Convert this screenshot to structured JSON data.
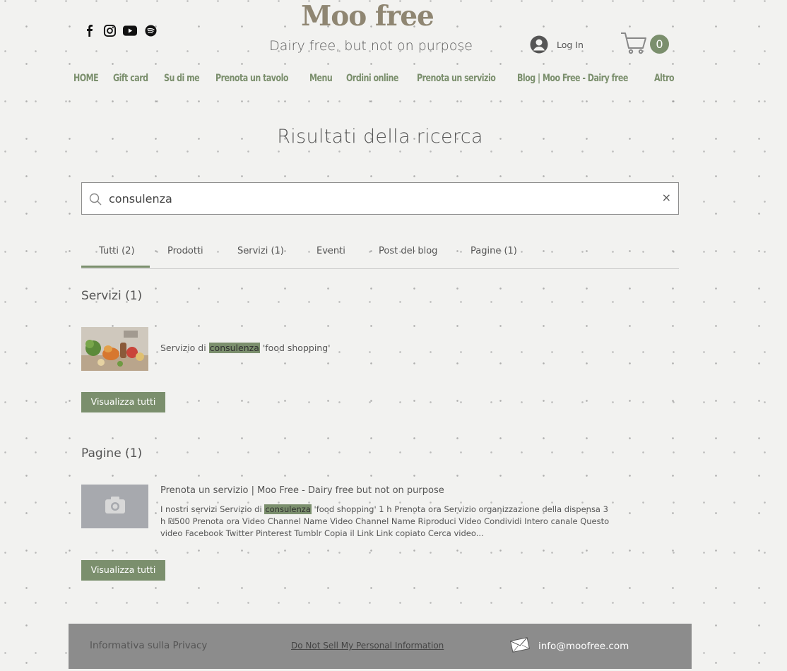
{
  "header": {
    "logo_title": "Moo free",
    "logo_subtitle": "Dairy free, but not on purpose",
    "login_label": "Log In",
    "cart_count": "0",
    "social_icons": [
      "facebook-icon",
      "instagram-icon",
      "youtube-icon",
      "spotify-icon"
    ]
  },
  "nav": {
    "items": [
      "HOME",
      "Gift card",
      "Su di me",
      "Prenota un tavolo",
      "Menu",
      "Ordini online",
      "Prenota un servizio",
      "Blog | Moo Free - Dairy free",
      "Altro"
    ]
  },
  "main": {
    "title": "Risultati della ricerca",
    "search": {
      "value": "consulenza",
      "clear": "×"
    },
    "tabs": [
      {
        "label": "Tutti (2)",
        "active": true
      },
      {
        "label": "Prodotti",
        "active": false
      },
      {
        "label": "Servizi (1)",
        "active": false
      },
      {
        "label": "Eventi",
        "active": false
      },
      {
        "label": "Post del blog",
        "active": false
      },
      {
        "label": "Pagine (1)",
        "active": false
      }
    ],
    "services": {
      "title": "Servizi (1)",
      "result": {
        "prefix": "Servizio di ",
        "highlight": "consulenza",
        "suffix": " 'food shopping'"
      },
      "view_all": "Visualizza tutti"
    },
    "pages": {
      "title": "Pagine (1)",
      "result": {
        "title": "Prenota un servizio | Moo Free - Dairy free but not on purpose",
        "snippet_prefix": "I nostri servizi Servizio di ",
        "snippet_highlight": "consulenza",
        "snippet_suffix": " 'food shopping' 1 h Prenota ora Servizio organizzazione della dispensa 3 h ₪500 Prenota ora Video Channel Name Video Channel Name Riproduci Video Condividi Intero canale Questo video Facebook Twitter Pinterest Tumblr Copia il Link Link copiato Cerca video..."
      },
      "view_all": "Visualizza tutti"
    }
  },
  "footer": {
    "privacy": "Informativa sulla Privacy",
    "do_not_sell": "Do Not Sell My Personal Information",
    "email": "info@moofree.com"
  },
  "colors": {
    "accent": "#7b8f6d",
    "logo": "#8f8672",
    "footer_bg": "#8c8c8c",
    "background": "#f2f2f0"
  }
}
